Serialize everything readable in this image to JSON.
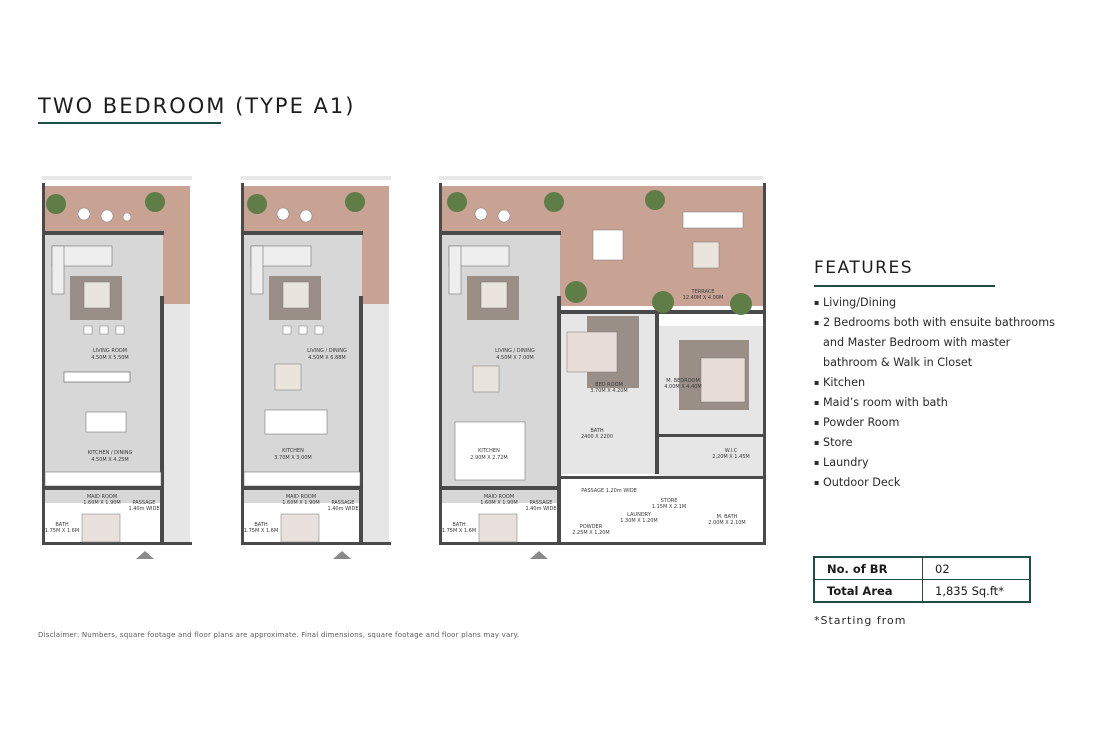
{
  "title": "TWO BEDROOM (TYPE A1)",
  "plans": [
    {
      "labels": {
        "living": [
          "LIVING ROOM",
          "4.50M X 5.50M"
        ],
        "kitchen": [
          "KITCHEN / DINING",
          "4.50M X 4.25M"
        ],
        "maid": [
          "MAID ROOM",
          "1.60M X 1.90M"
        ],
        "passage": [
          "PASSAGE",
          "1.40m WIDE"
        ],
        "bath": [
          "BATH",
          "1.75M X 1.6M"
        ]
      }
    },
    {
      "labels": {
        "living": [
          "LIVING / DINING",
          "4.50M X 6.88M"
        ],
        "kitchen": [
          "KITCHEN",
          "3.70M X 3.00M"
        ],
        "maid": [
          "MAID ROOM",
          "1.60M X 1.90M"
        ],
        "passage": [
          "PASSAGE",
          "1.40m WIDE"
        ],
        "bath": [
          "BATH",
          "1.75M X 1.6M"
        ]
      }
    },
    {
      "labels": {
        "living": [
          "LIVING / DINING",
          "4.50M X 7.00M"
        ],
        "kitchen": [
          "KITCHEN",
          "2.90M X 2.72M"
        ],
        "maid": [
          "MAID ROOM",
          "1.60M X 1.90M"
        ],
        "passage": [
          "PASSAGE",
          "1.40m WIDE"
        ],
        "bath": [
          "BATH",
          "1.75M X 1.6M"
        ],
        "terrace": [
          "TERRACE",
          "12.40M X 4.00M"
        ],
        "bedroom": [
          "BED ROOM",
          "3.70M X 4.20M"
        ],
        "mbedroom": [
          "M. BEDROOM",
          "4.00M X 4.40M"
        ],
        "bath2": [
          "BATH",
          "2400 X 2200"
        ],
        "passage2": [
          "PASSAGE 1.20m WIDE"
        ],
        "wic": [
          "W.I.C",
          "2.20M X 1.45M"
        ],
        "store": [
          "STORE",
          "1.15M X 2.1M"
        ],
        "laundry": [
          "LAUNDRY",
          "1.30M X 1.20M"
        ],
        "powder": [
          "POWDER",
          "2.25M X 1.20M"
        ],
        "mbath": [
          "M. BATH",
          "2.00M X 2.10M"
        ]
      }
    }
  ],
  "features": {
    "title": "FEATURES",
    "items": [
      "Living/Dining",
      "2 Bedrooms both with ensuite bathrooms and Master Bedroom with master bathroom & Walk in Closet",
      "Kitchen",
      "Maid’s room with bath",
      "Powder Room",
      "Store",
      "Laundry",
      "Outdoor Deck"
    ]
  },
  "specs": {
    "rows": [
      {
        "label": "No. of BR",
        "value": "02"
      },
      {
        "label": "Total Area",
        "value": "1,835 Sq.ft*"
      }
    ],
    "note": "*Starting from"
  },
  "disclaimer": "Disclaimer: Numbers, square footage and floor plans are approximate. Final dimensions, square footage and floor plans may vary.",
  "colors": {
    "accent": "#1f4e45",
    "deck": "#c8a394",
    "floor": "#d7d7d7",
    "wall": "#4a4a4a",
    "rug": "#9a8f86",
    "plant": "#5e7d47"
  },
  "icons": [
    "plant-icon",
    "chair-icon",
    "sofa-icon",
    "bed-icon",
    "table-icon",
    "direction-marker-icon"
  ]
}
